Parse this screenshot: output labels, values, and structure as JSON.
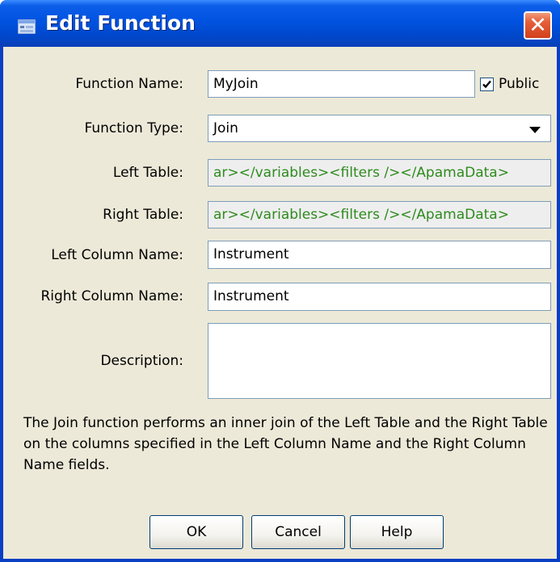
{
  "window": {
    "title": "Edit Function",
    "close_glyph": "✕",
    "titlebar_color": "#0053e1"
  },
  "form": {
    "function_name": {
      "label": "Function Name:",
      "value": "MyJoin"
    },
    "public": {
      "label": "Public",
      "checked": true
    },
    "function_type": {
      "label": "Function Type:",
      "value": "Join"
    },
    "left_table": {
      "label": "Left Table:",
      "value": "ar></variables><filters /></ApamaData>"
    },
    "right_table": {
      "label": "Right Table:",
      "value": "ar></variables><filters /></ApamaData>"
    },
    "left_column_name": {
      "label": "Left Column Name:",
      "value": "Instrument"
    },
    "right_column_name": {
      "label": "Right Column Name:",
      "value": "Instrument"
    },
    "description": {
      "label": "Description:",
      "value": ""
    }
  },
  "help_text": "The Join function performs an inner join of the Left Table and the Right Table on the columns specified in the Left Column Name and the Right Column Name fields.",
  "buttons": {
    "ok": "OK",
    "cancel": "Cancel",
    "help": "Help"
  },
  "icons": {
    "app": "app-window-icon",
    "close": "close-icon",
    "checkbox": "check-icon",
    "dropdown": "chevron-down-icon"
  },
  "colors": {
    "dialog_bg": "#ece9d8",
    "readonly_text": "#2e8b1e",
    "close_red": "#d2401c"
  }
}
